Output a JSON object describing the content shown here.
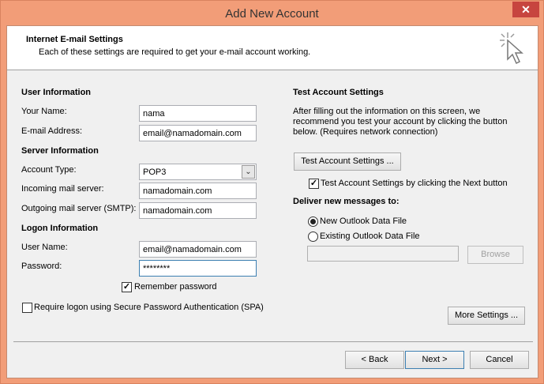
{
  "window": {
    "title": "Add New Account",
    "close_glyph": "✕"
  },
  "header": {
    "title": "Internet E-mail Settings",
    "subtitle": "Each of these settings are required to get your e-mail account working."
  },
  "user_info": {
    "heading": "User Information",
    "name_label": "Your Name:",
    "name_value": "nama",
    "email_label": "E-mail Address:",
    "email_value": "email@namadomain.com"
  },
  "server_info": {
    "heading": "Server Information",
    "account_type_label": "Account Type:",
    "account_type_value": "POP3",
    "incoming_label": "Incoming mail server:",
    "incoming_value": "namadomain.com",
    "outgoing_label": "Outgoing mail server (SMTP):",
    "outgoing_value": "namadomain.com"
  },
  "logon_info": {
    "heading": "Logon Information",
    "username_label": "User Name:",
    "username_value": "email@namadomain.com",
    "password_label": "Password:",
    "password_value": "********",
    "remember_label": "Remember password",
    "remember_checked": true,
    "spa_label": "Require logon using Secure Password Authentication (SPA)",
    "spa_checked": false
  },
  "test_settings": {
    "heading": "Test Account Settings",
    "description_line1": "After filling out the information on this screen, we",
    "description_line2": "recommend you test your account by clicking the button",
    "description_line3": "below. (Requires network connection)",
    "test_button": "Test Account Settings ...",
    "test_on_next_label": "Test Account Settings by clicking the Next button",
    "test_on_next_checked": true
  },
  "deliver": {
    "heading": "Deliver new messages to:",
    "option_new": "New Outlook Data File",
    "option_existing": "Existing Outlook Data File",
    "selected": "new",
    "existing_path": "",
    "browse_button": "Browse"
  },
  "more_settings_button": "More Settings ...",
  "footer": {
    "back_button": "< Back",
    "next_button": "Next >",
    "cancel_button": "Cancel"
  },
  "colors": {
    "title_bar": "#f29d78",
    "close_button": "#c7453f",
    "dialog_bg": "#f0f0f0"
  },
  "icons": {
    "header_icon": "pointer-cursor-sparkle-icon",
    "dropdown": "chevron-down-icon",
    "check": "checkmark-icon"
  }
}
